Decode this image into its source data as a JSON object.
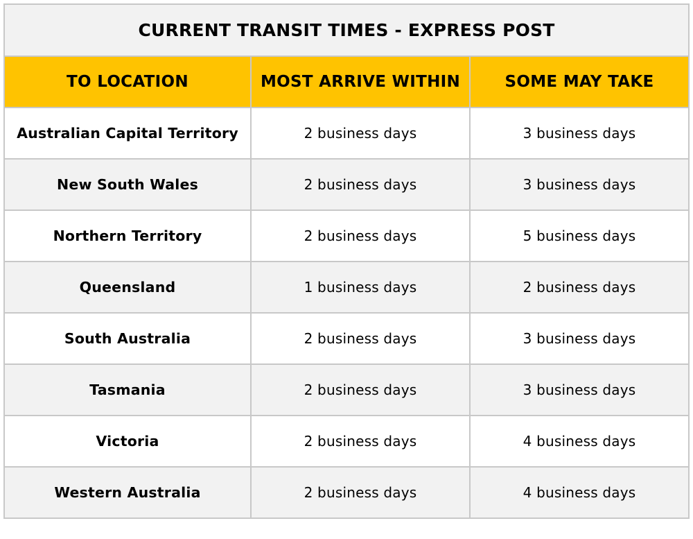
{
  "table": {
    "title": "CURRENT TRANSIT TIMES - EXPRESS POST",
    "headers": [
      "TO LOCATION",
      "MOST ARRIVE WITHIN",
      "SOME MAY TAKE"
    ],
    "rows": [
      {
        "location": "Australian Capital Territory",
        "most_arrive_within": "2 business days",
        "some_may_take": "3 business days"
      },
      {
        "location": "New South Wales",
        "most_arrive_within": "2 business days",
        "some_may_take": "3 business days"
      },
      {
        "location": "Northern Territory",
        "most_arrive_within": "2 business days",
        "some_may_take": "5 business days"
      },
      {
        "location": "Queensland",
        "most_arrive_within": "1 business days",
        "some_may_take": "2 business days"
      },
      {
        "location": "South Australia",
        "most_arrive_within": "2 business days",
        "some_may_take": "3 business days"
      },
      {
        "location": "Tasmania",
        "most_arrive_within": "2 business days",
        "some_may_take": "3 business days"
      },
      {
        "location": "Victoria",
        "most_arrive_within": "2 business days",
        "some_may_take": "4 business days"
      },
      {
        "location": "Western Australia",
        "most_arrive_within": "2 business days",
        "some_may_take": "4 business days"
      }
    ]
  },
  "colors": {
    "header_background": "#FFC300",
    "title_background": "#F2F2F2",
    "alt_row_background": "#F2F2F2",
    "row_background": "#FFFFFF",
    "border": "#C8C8C8",
    "text": "#000000"
  }
}
